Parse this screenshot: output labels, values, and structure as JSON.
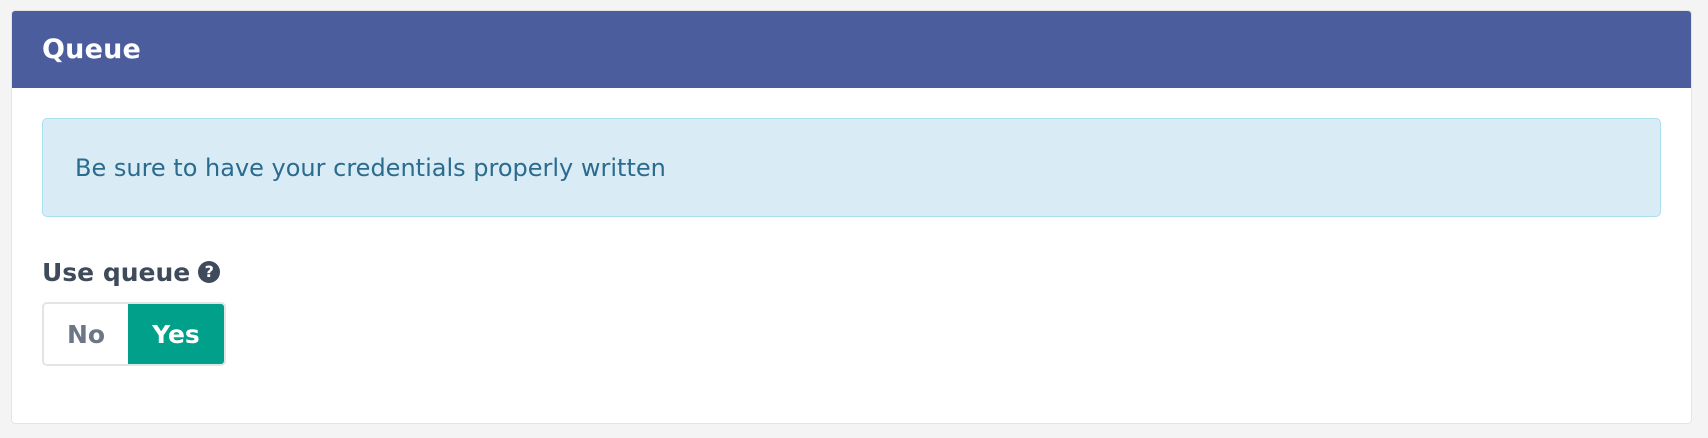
{
  "panel": {
    "title": "Queue"
  },
  "alert": {
    "text": "Be sure to have your credentials properly written"
  },
  "use_queue": {
    "label": "Use queue",
    "help_icon": "question-circle-icon",
    "options": [
      "No",
      "Yes"
    ],
    "selected": "Yes"
  },
  "colors": {
    "header": "#4c5d9e",
    "alert_bg": "#d9ecf6",
    "alert_text": "#2a6b8e",
    "selected": "#00a08a"
  }
}
